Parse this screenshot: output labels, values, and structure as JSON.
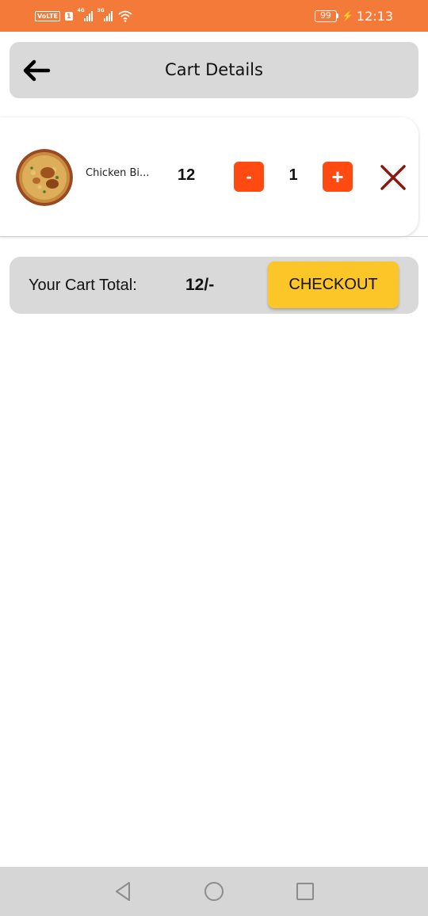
{
  "status_bar": {
    "volte": "VoLTE",
    "sim1": "1",
    "signal1_tag": "4G",
    "signal2_tag": "3G",
    "battery": "99",
    "time": "12:13"
  },
  "header": {
    "title": "Cart Details",
    "back_icon": "arrow-left-icon"
  },
  "cart_items": [
    {
      "name": "Chicken Bi...",
      "price": "12",
      "quantity": "1",
      "minus_label": "-",
      "plus_label": "+",
      "image_icon": "chicken-biryani-image"
    }
  ],
  "summary": {
    "total_label": "Your Cart Total:",
    "total_value": "12/-",
    "checkout_label": "CHECKOUT"
  },
  "nav": {
    "back": "triangle-back-icon",
    "home": "circle-home-icon",
    "recents": "square-recents-icon"
  },
  "colors": {
    "status_bar": "#f47a3a",
    "qty_button": "#ff4a12",
    "remove_x": "#8b1a0e",
    "checkout": "#fcc629",
    "panel_gray": "#d9d9d9"
  }
}
